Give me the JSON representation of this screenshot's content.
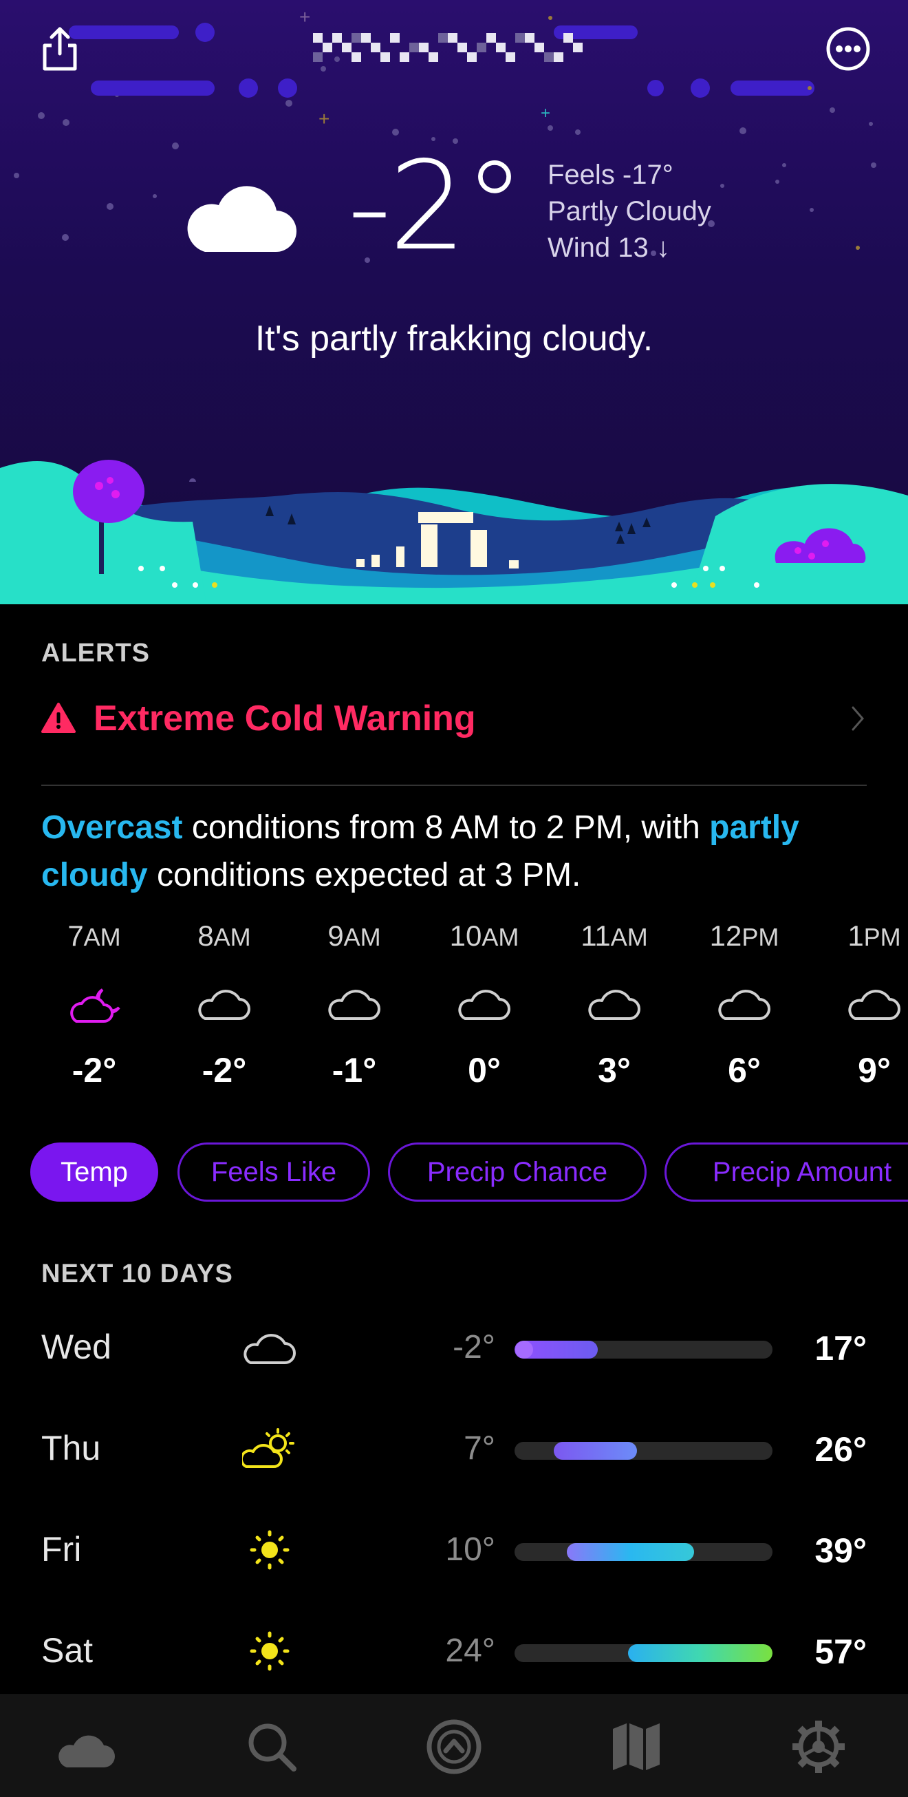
{
  "header": {
    "share_icon": "share-icon",
    "more_icon": "ellipsis-circle-icon",
    "location_text": ""
  },
  "current": {
    "condition_icon": "partly-cloudy-night-icon",
    "temperature": "-2°",
    "feels_like": "Feels -17°",
    "condition": "Partly Cloudy",
    "wind": "Wind 13 ↓",
    "tagline": "It's partly frakking cloudy."
  },
  "alerts": {
    "title": "ALERTS",
    "items": [
      {
        "label": "Extreme Cold Warning",
        "icon": "warning-triangle-icon",
        "color": "#ff2a62"
      }
    ]
  },
  "summary": {
    "hl1": "Overcast",
    "part1": " conditions from 8 AM to 2 PM, with ",
    "hl2": "partly cloudy",
    "part2": " conditions expected at 3 PM.",
    "highlight_color": "#28b8f0"
  },
  "hourly": [
    {
      "hour": "7",
      "ampm": "AM",
      "icon": "partly-cloudy-night-icon",
      "temp": "-2°"
    },
    {
      "hour": "8",
      "ampm": "AM",
      "icon": "cloud-icon",
      "temp": "-2°"
    },
    {
      "hour": "9",
      "ampm": "AM",
      "icon": "cloud-icon",
      "temp": "-1°"
    },
    {
      "hour": "10",
      "ampm": "AM",
      "icon": "cloud-icon",
      "temp": "0°"
    },
    {
      "hour": "11",
      "ampm": "AM",
      "icon": "cloud-icon",
      "temp": "3°"
    },
    {
      "hour": "12",
      "ampm": "PM",
      "icon": "cloud-icon",
      "temp": "6°"
    },
    {
      "hour": "1",
      "ampm": "PM",
      "icon": "cloud-icon",
      "temp": "9°"
    }
  ],
  "graph_tabs": {
    "items": [
      "Temp",
      "Feels Like",
      "Precip Chance",
      "Precip Amount"
    ],
    "selected": "Temp",
    "accent": "#7a16ef"
  },
  "daily": {
    "title": "NEXT 10 DAYS",
    "days": [
      {
        "day": "Wed",
        "icon": "cloud-icon",
        "low": "-2°",
        "high": "17°"
      },
      {
        "day": "Thu",
        "icon": "partly-sunny-icon",
        "low": "7°",
        "high": "26°"
      },
      {
        "day": "Fri",
        "icon": "sun-icon",
        "low": "10°",
        "high": "39°"
      },
      {
        "day": "Sat",
        "icon": "sun-icon",
        "low": "24°",
        "high": "57°"
      }
    ],
    "range_min": -2,
    "range_max": 57
  },
  "tabbar": {
    "items": [
      {
        "name": "weather",
        "icon": "cloud-moon-icon",
        "active": true
      },
      {
        "name": "search",
        "icon": "search-icon",
        "active": false
      },
      {
        "name": "time-machine",
        "icon": "time-machine-icon",
        "active": false
      },
      {
        "name": "maps",
        "icon": "map-icon",
        "active": false
      },
      {
        "name": "settings",
        "icon": "gear-icon",
        "active": false
      }
    ]
  }
}
